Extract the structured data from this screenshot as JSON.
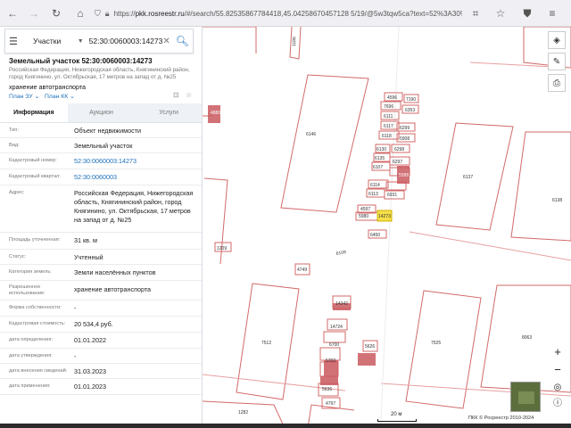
{
  "browser": {
    "url_prefix": "https://",
    "url_host": "pkk.rosreestr.ru",
    "url_rest": "/#/search/55.82535867784418,45.04258670457128 5/19/@5w3tqw5ca?text=52%3A30%3A0060"
  },
  "search": {
    "type_label": "Участки",
    "query": "52:30:0060003:14273"
  },
  "parcel": {
    "title": "Земельный участок 52:30:0060003:14273",
    "address_short": "Российская Федерация, Нижегородская область, Княгининский район, город Княгинино, ул. Октябрьская, 17 метров на запад от д. №25",
    "purpose": "хранение автотранспорта",
    "plan_zu": "План ЗУ ⌄",
    "plan_kk": "План КК ⌄"
  },
  "tabs": [
    {
      "label": "Информация",
      "active": true
    },
    {
      "label": "Аукцион",
      "active": false
    },
    {
      "label": "Услуги",
      "active": false
    }
  ],
  "info_rows": [
    {
      "label": "Тип:",
      "value": "Объект недвижимости"
    },
    {
      "label": "Вид:",
      "value": "Земельный участок"
    },
    {
      "label": "Кадастровый номер:",
      "value": "52:30:0060003:14273",
      "link": true
    },
    {
      "label": "Кадастровый квартал:",
      "value": "52:30:0060003",
      "link": true
    },
    {
      "label": "Адрес:",
      "value": "Российская Федерация, Нижегородская область, Княгининский район, город Княгинино, ул. Октябрьская, 17 метров на запад от д. №25"
    },
    {
      "label": "Площадь уточненная:",
      "value": "31 кв. м"
    },
    {
      "label": "Статус:",
      "value": "Учтенный"
    },
    {
      "label": "Категория земель:",
      "value": "Земли населённых пунктов"
    },
    {
      "label": "Разрешенное использование:",
      "value": "хранение автотранспорта"
    },
    {
      "label": "Форма собственности:",
      "value": "-"
    },
    {
      "label": "Кадастровая стоимость:",
      "value": "20 534,4 руб."
    },
    {
      "label": "дата определения:",
      "value": "01.01.2022"
    },
    {
      "label": "дата утверждения:",
      "value": "-"
    },
    {
      "label": "дата внесения сведений:",
      "value": "31.03.2023"
    },
    {
      "label": "дата применения:",
      "value": "01.01.2023"
    }
  ],
  "map": {
    "scale_label": "20 м",
    "copyright": "ПКК © Росреестр 2010-2024",
    "parcels": [
      {
        "label": "6146"
      },
      {
        "label": "6137"
      },
      {
        "label": "6138"
      },
      {
        "label": "4827"
      },
      {
        "label": "1186"
      },
      {
        "label": "4596"
      },
      {
        "label": "7190"
      },
      {
        "label": "7696"
      },
      {
        "label": "6353"
      },
      {
        "label": "6111"
      },
      {
        "label": "6117"
      },
      {
        "label": "6118"
      },
      {
        "label": "5908"
      },
      {
        "label": "6299"
      },
      {
        "label": "6130"
      },
      {
        "label": "6298"
      },
      {
        "label": "6135"
      },
      {
        "label": "6297"
      },
      {
        "label": "6107"
      },
      {
        "label": "5588"
      },
      {
        "label": "6114"
      },
      {
        "label": "6113"
      },
      {
        "label": "6931"
      },
      {
        "label": "4597"
      },
      {
        "label": "5980"
      },
      {
        "label": "14273"
      },
      {
        "label": "6450"
      },
      {
        "label": "6109"
      },
      {
        "label": "7512"
      },
      {
        "label": "7525"
      },
      {
        "label": "8063"
      },
      {
        "label": "14342"
      },
      {
        "label": "14724"
      },
      {
        "label": "5626"
      },
      {
        "label": "6700"
      },
      {
        "label": "5703"
      },
      {
        "label": "5636"
      },
      {
        "label": "4797"
      },
      {
        "label": "1282"
      },
      {
        "label": "4880"
      },
      {
        "label": "1209"
      },
      {
        "label": "4749"
      }
    ]
  }
}
